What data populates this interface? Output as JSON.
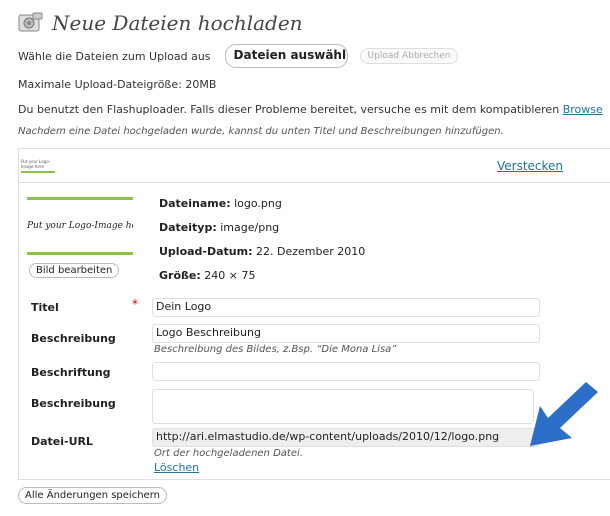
{
  "page": {
    "title": "Neue Dateien hochladen",
    "choose_label": "Wähle die Dateien zum Upload aus",
    "choose_button": "Dateien auswähl",
    "cancel_button": "Upload Abbrechen",
    "max_size": "Maximale Upload-Dateigröße: 20MB",
    "flash_notice": "Du benutzt den Flashuploader. Falls dieser Probleme bereitet, versuche es mit dem kompatibleren",
    "browser_link": "Browse",
    "hint": "Nachdem eine Datei hochgeladen wurde, kannst du unten Titel und Beschreibungen hinzufügen.",
    "save_all": "Alle Änderungen speichern"
  },
  "item": {
    "thumb_text": "Put your Logo-Image here",
    "hide_link": "Verstecken",
    "edit_button": "Bild bearbeiten",
    "filename_label": "Dateiname:",
    "filename": "logo.png",
    "filetype_label": "Dateityp:",
    "filetype": "image/png",
    "date_label": "Upload-Datum:",
    "date": "22. Dezember 2010",
    "size_label": "Größe:",
    "size": "240 × 75"
  },
  "form": {
    "title_label": "Titel",
    "required_mark": "*",
    "title_value": "Dein Logo",
    "alt_label": "Beschreibung",
    "alt_value": "Logo Beschreibung",
    "alt_help": "Beschreibung des Bildes, z.Bsp. “Die Mona Lisa”",
    "caption_label": "Beschriftung",
    "caption_value": "",
    "desc_label": "Beschreibung",
    "url_label": "Datei-URL",
    "url_value": "http://ari.elmastudio.de/wp-content/uploads/2010/12/logo.png",
    "url_help": "Ort der hochgeladenen Datei.",
    "delete_link": "Löschen"
  },
  "colors": {
    "link": "#21759b",
    "accent_green": "#8bc34a",
    "arrow": "#2c6fc9",
    "required": "#dd0000"
  }
}
